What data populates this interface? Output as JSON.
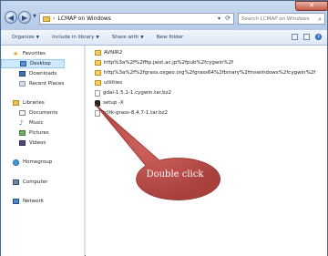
{
  "window": {
    "address_path": "LCMAP on Windows",
    "search_placeholder": "Search LCMAP on Windows",
    "close_glyph": "✕"
  },
  "toolbar": {
    "items": [
      "Organize",
      "Include in library",
      "Share with",
      "New folder"
    ]
  },
  "nav": {
    "favorites": "Favorites",
    "desktop": "Desktop",
    "downloads": "Downloads",
    "recent": "Recent Places",
    "libraries": "Libraries",
    "documents": "Documents",
    "music": "Music",
    "pictures": "Pictures",
    "videos": "Videos",
    "homegroup": "Homegroup",
    "computer": "Computer",
    "network": "Network"
  },
  "files": [
    {
      "name": "AVNIR2",
      "kind": "folder"
    },
    {
      "name": "http%3a%2f%2fftp.jaist.ac.jp%2fpub%2fcygwin%2f",
      "kind": "folder"
    },
    {
      "name": "http%3a%2f%2fgrass.osgeo.org%2fgrass64%2fbinary%2fmswindows%2fcygwin%2f",
      "kind": "folder"
    },
    {
      "name": "utilities",
      "kind": "folder"
    },
    {
      "name": "gdal-1.5.1-1.cygwin.tar.bz2",
      "kind": "file"
    },
    {
      "name": "setup -X",
      "kind": "exe"
    },
    {
      "name": "tcltk-grass-8.4.7-1.tar.bz2",
      "kind": "file"
    }
  ],
  "callout": {
    "text": "Double click",
    "color": "#c0504d"
  }
}
